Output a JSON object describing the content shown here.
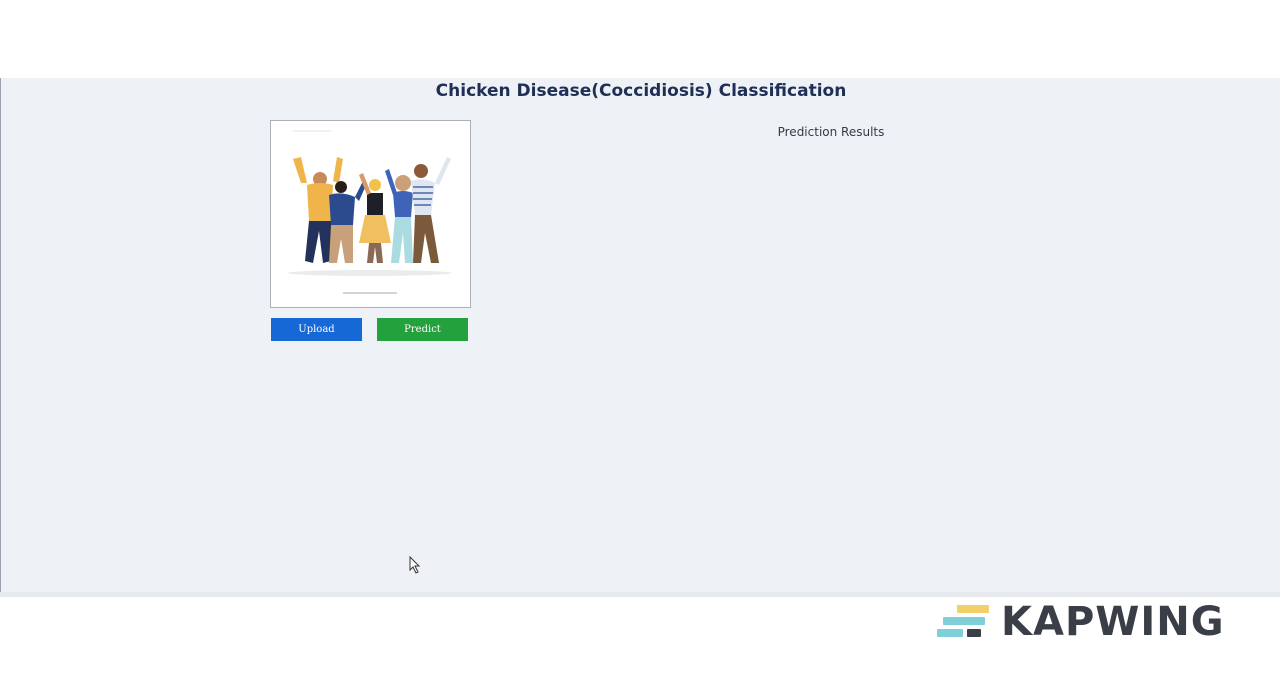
{
  "page": {
    "title": "Chicken Disease(Coccidiosis) Classification"
  },
  "buttons": {
    "upload_label": "Upload",
    "predict_label": "Predict"
  },
  "results": {
    "label": "Prediction Results"
  },
  "preview": {
    "icon": "people-celebrating-illustration"
  },
  "watermark": {
    "text": "KAPWING"
  },
  "colors": {
    "title": "#1f2f55",
    "upload": "#1668d6",
    "predict": "#22a13c",
    "background": "#eef2f6"
  }
}
